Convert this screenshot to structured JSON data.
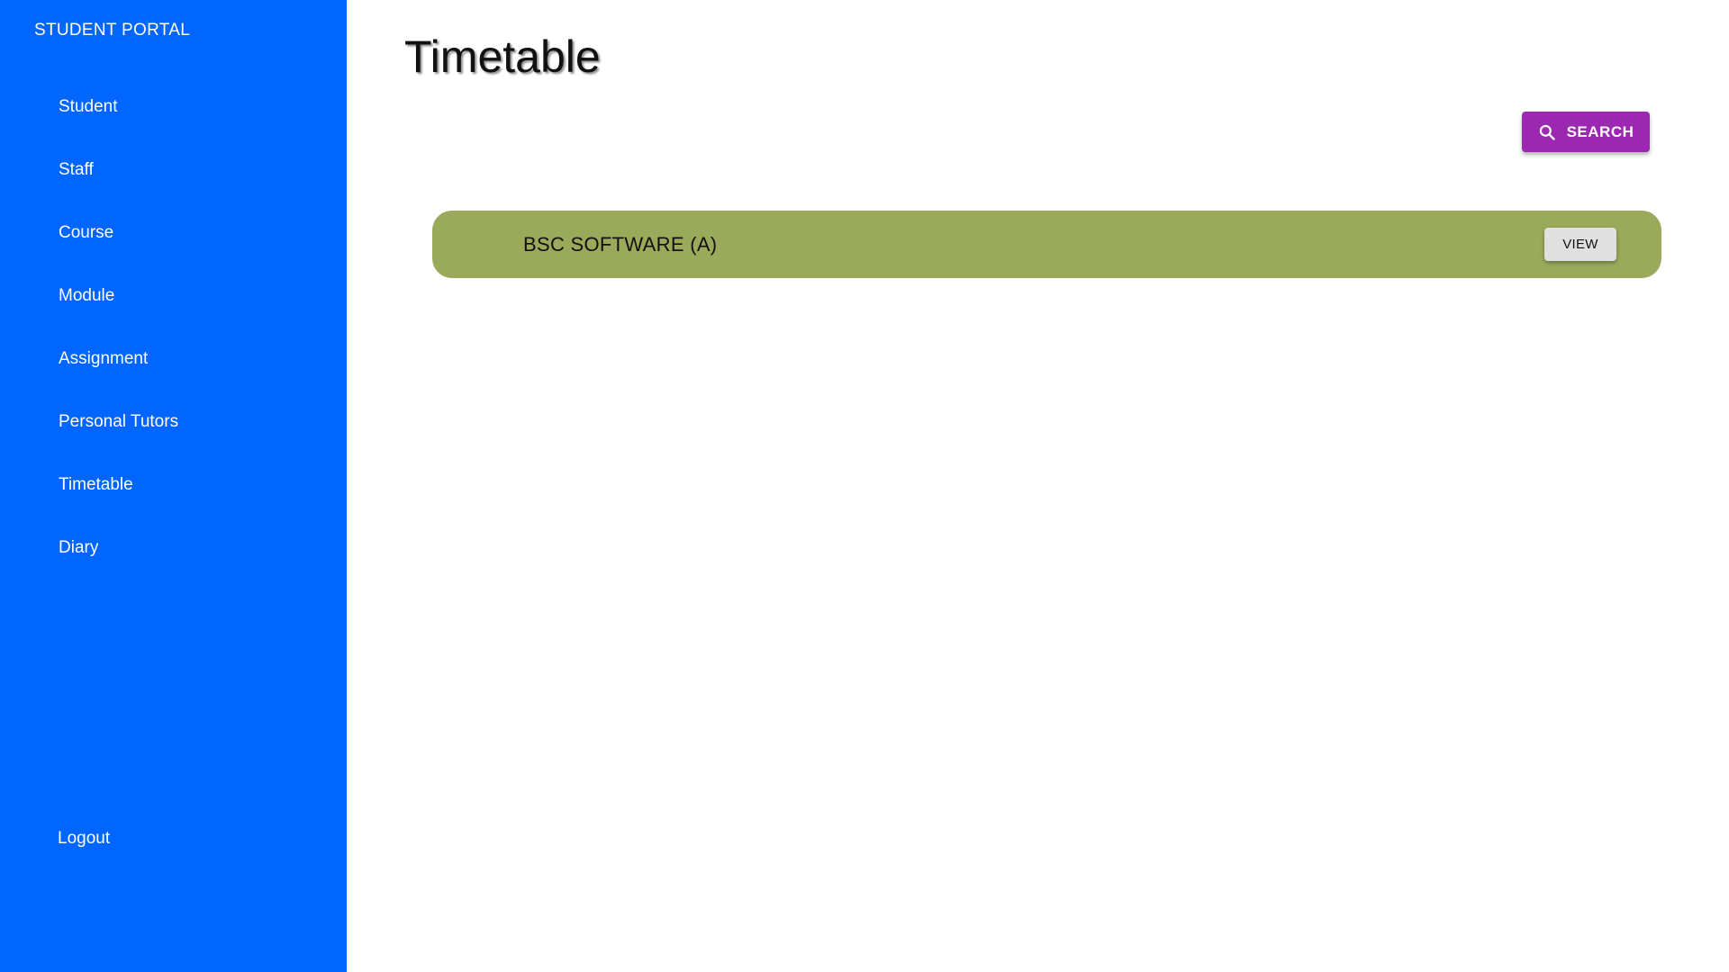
{
  "sidebar": {
    "brand": "STUDENT PORTAL",
    "items": [
      {
        "label": "Student"
      },
      {
        "label": "Staff"
      },
      {
        "label": "Course"
      },
      {
        "label": "Module"
      },
      {
        "label": "Assignment"
      },
      {
        "label": "Personal Tutors"
      },
      {
        "label": "Timetable"
      },
      {
        "label": "Diary"
      }
    ],
    "logout_label": "Logout"
  },
  "main": {
    "title": "Timetable",
    "search_button": {
      "label": "SEARCH",
      "icon": "search-icon"
    },
    "courses": [
      {
        "name": "BSC SOFTWARE (A)",
        "action_label": "VIEW"
      }
    ]
  },
  "colors": {
    "sidebar_bg": "#0066ff",
    "search_button_bg": "#9c27b0",
    "course_row_bg": "#9aaa5a",
    "view_button_bg": "#e0e0e0"
  }
}
